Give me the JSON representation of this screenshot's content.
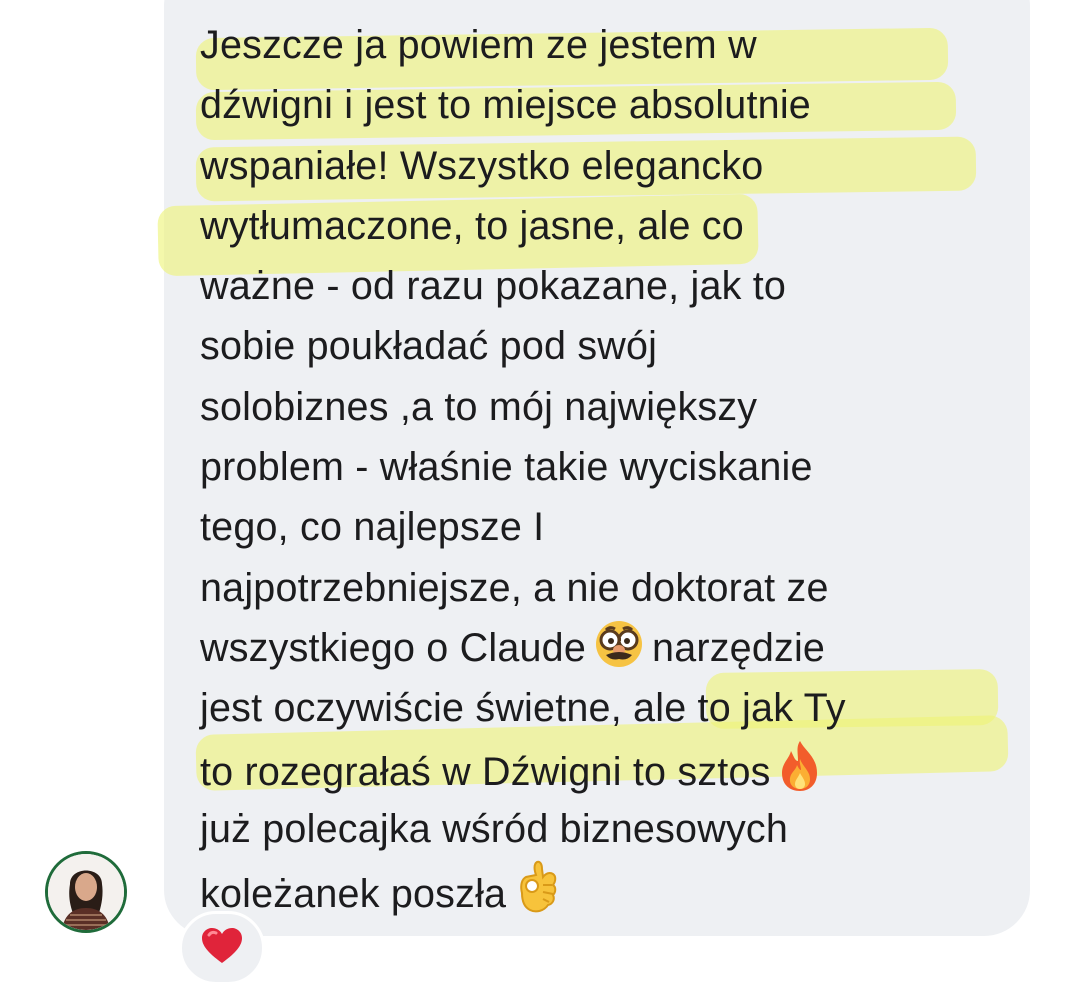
{
  "message": {
    "lines": [
      "Jeszcze ja powiem ze jestem w",
      "dźwigni i jest to miejsce absolutnie",
      "wspaniałe! Wszystko elegancko",
      "wytłumaczone, to jasne, ale co",
      "ważne - od razu pokazane, jak to",
      "sobie poukładać pod swój",
      "solobiznes ,a to mój największy",
      "problem - właśnie takie wyciskanie",
      "tego, co najlepsze I",
      "najpotrzebniejsze, a nie doktorat ze",
      "wszystkiego o Claude",
      "narzędzie",
      "jest oczywiście świetne, ale to jak Ty",
      "to rozegrałaś w Dźwigni to sztos",
      "już polecajka wśród biznesowych",
      "koleżanek poszła"
    ],
    "emojis": {
      "line11": "disguised-face-glasses-emoji",
      "line14": "fire-emoji",
      "line16": "ok-hand-emoji"
    }
  },
  "reaction": {
    "emoji": "red-heart-emoji"
  },
  "colors": {
    "bubble": "#eef0f3",
    "text": "#1c1c1e",
    "highlight": "#eef478",
    "avatar_ring": "#1f6b3a"
  }
}
